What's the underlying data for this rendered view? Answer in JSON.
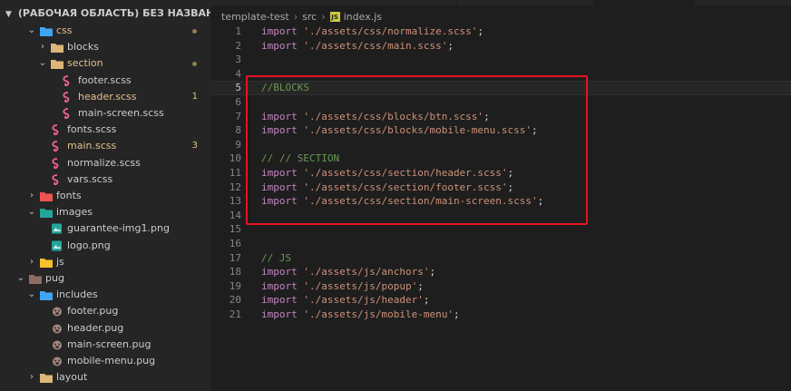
{
  "explorer": {
    "workspace_title": "(РАБОЧАЯ ОБЛАСТЬ) БЕЗ НАЗВАНИЯ",
    "items": [
      {
        "label": "css",
        "kind": "folder-open",
        "modified": true,
        "badge": "",
        "dot": true
      },
      {
        "label": "blocks",
        "kind": "folder-closed",
        "modified": false,
        "badge": "",
        "dot": false
      },
      {
        "label": "section",
        "kind": "folder-open",
        "modified": true,
        "badge": "",
        "dot": true
      },
      {
        "label": "footer.scss",
        "kind": "scss",
        "modified": false,
        "badge": "",
        "dot": false
      },
      {
        "label": "header.scss",
        "kind": "scss",
        "modified": true,
        "badge": "1",
        "dot": false
      },
      {
        "label": "main-screen.scss",
        "kind": "scss",
        "modified": false,
        "badge": "",
        "dot": false
      },
      {
        "label": "fonts.scss",
        "kind": "scss",
        "modified": false,
        "badge": "",
        "dot": false
      },
      {
        "label": "main.scss",
        "kind": "scss",
        "modified": true,
        "badge": "3",
        "dot": false
      },
      {
        "label": "normalize.scss",
        "kind": "scss",
        "modified": false,
        "badge": "",
        "dot": false
      },
      {
        "label": "vars.scss",
        "kind": "scss",
        "modified": false,
        "badge": "",
        "dot": false
      },
      {
        "label": "fonts",
        "kind": "folder-closed",
        "modified": false,
        "badge": "",
        "dot": false
      },
      {
        "label": "images",
        "kind": "folder-open",
        "modified": false,
        "badge": "",
        "dot": false
      },
      {
        "label": "guarantee-img1.png",
        "kind": "png",
        "modified": false,
        "badge": "",
        "dot": false
      },
      {
        "label": "logo.png",
        "kind": "png",
        "modified": false,
        "badge": "",
        "dot": false
      },
      {
        "label": "js",
        "kind": "folder-closed",
        "modified": false,
        "badge": "",
        "dot": false
      },
      {
        "label": "pug",
        "kind": "folder-open",
        "modified": false,
        "badge": "",
        "dot": false
      },
      {
        "label": "includes",
        "kind": "folder-open",
        "modified": false,
        "badge": "",
        "dot": false
      },
      {
        "label": "footer.pug",
        "kind": "pug",
        "modified": false,
        "badge": "",
        "dot": false
      },
      {
        "label": "header.pug",
        "kind": "pug",
        "modified": false,
        "badge": "",
        "dot": false
      },
      {
        "label": "main-screen.pug",
        "kind": "pug",
        "modified": false,
        "badge": "",
        "dot": false
      },
      {
        "label": "mobile-menu.pug",
        "kind": "pug",
        "modified": false,
        "badge": "",
        "dot": false
      },
      {
        "label": "layout",
        "kind": "folder-closed",
        "modified": false,
        "badge": "",
        "dot": false
      }
    ]
  },
  "breadcrumb": {
    "project": "template-test",
    "folder": "src",
    "file_badge": "JS",
    "file": "index.js"
  },
  "editor": {
    "current_line": 5,
    "lines": [
      {
        "n": "1",
        "tokens": [
          [
            "kw",
            "import"
          ],
          [
            "pn",
            " "
          ],
          [
            "str",
            "'./assets/css/normalize.scss'"
          ],
          [
            "pn",
            ";"
          ]
        ]
      },
      {
        "n": "2",
        "tokens": [
          [
            "kw",
            "import"
          ],
          [
            "pn",
            " "
          ],
          [
            "str",
            "'./assets/css/main.scss'"
          ],
          [
            "pn",
            ";"
          ]
        ]
      },
      {
        "n": "3",
        "tokens": []
      },
      {
        "n": "4",
        "tokens": []
      },
      {
        "n": "5",
        "tokens": [
          [
            "cm",
            "//BLOCKS"
          ]
        ]
      },
      {
        "n": "6",
        "tokens": []
      },
      {
        "n": "7",
        "tokens": [
          [
            "kw",
            "import"
          ],
          [
            "pn",
            " "
          ],
          [
            "str",
            "'./assets/css/blocks/btn.scss'"
          ],
          [
            "pn",
            ";"
          ]
        ]
      },
      {
        "n": "8",
        "tokens": [
          [
            "kw",
            "import"
          ],
          [
            "pn",
            " "
          ],
          [
            "str",
            "'./assets/css/blocks/mobile-menu.scss'"
          ],
          [
            "pn",
            ";"
          ]
        ]
      },
      {
        "n": "9",
        "tokens": []
      },
      {
        "n": "10",
        "tokens": [
          [
            "cm",
            "// // SECTION"
          ]
        ]
      },
      {
        "n": "11",
        "tokens": [
          [
            "kw",
            "import"
          ],
          [
            "pn",
            " "
          ],
          [
            "str",
            "'./assets/css/section/header.scss'"
          ],
          [
            "pn",
            ";"
          ]
        ]
      },
      {
        "n": "12",
        "tokens": [
          [
            "kw",
            "import"
          ],
          [
            "pn",
            " "
          ],
          [
            "str",
            "'./assets/css/section/footer.scss'"
          ],
          [
            "pn",
            ";"
          ]
        ]
      },
      {
        "n": "13",
        "tokens": [
          [
            "kw",
            "import"
          ],
          [
            "pn",
            " "
          ],
          [
            "str",
            "'./assets/css/section/main-screen.scss'"
          ],
          [
            "pn",
            ";"
          ]
        ]
      },
      {
        "n": "14",
        "tokens": []
      },
      {
        "n": "15",
        "tokens": []
      },
      {
        "n": "16",
        "tokens": []
      },
      {
        "n": "17",
        "tokens": [
          [
            "cm",
            "// JS"
          ]
        ]
      },
      {
        "n": "18",
        "tokens": [
          [
            "kw",
            "import"
          ],
          [
            "pn",
            " "
          ],
          [
            "str",
            "'./assets/js/anchors'"
          ],
          [
            "pn",
            ";"
          ]
        ]
      },
      {
        "n": "19",
        "tokens": [
          [
            "kw",
            "import"
          ],
          [
            "pn",
            " "
          ],
          [
            "str",
            "'./assets/js/popup'"
          ],
          [
            "pn",
            ";"
          ]
        ]
      },
      {
        "n": "20",
        "tokens": [
          [
            "kw",
            "import"
          ],
          [
            "pn",
            " "
          ],
          [
            "str",
            "'./assets/js/header'"
          ],
          [
            "pn",
            ";"
          ]
        ]
      },
      {
        "n": "21",
        "tokens": [
          [
            "kw",
            "import"
          ],
          [
            "pn",
            " "
          ],
          [
            "str",
            "'./assets/js/mobile-menu'"
          ],
          [
            "pn",
            ";"
          ]
        ]
      }
    ]
  },
  "colors": {
    "folder": "#dcb67a",
    "folder_css": "#42a5f5",
    "scss": "#f06292",
    "png": "#26a69a",
    "pug": "#a1887f",
    "highlight_box": "#e81123"
  }
}
